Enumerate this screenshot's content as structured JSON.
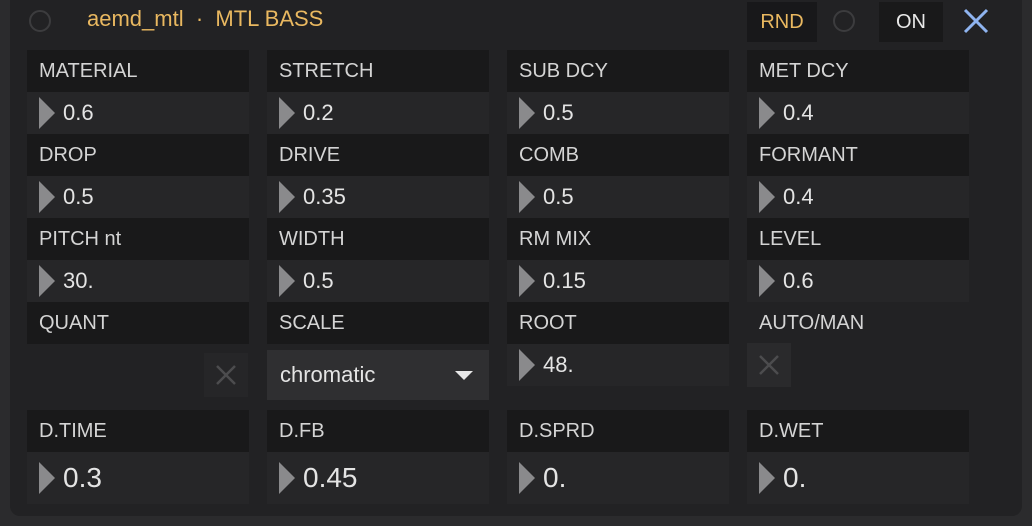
{
  "header": {
    "title": "aemd_mtl  ·  MTL BASS",
    "rnd_label": "RND",
    "on_label": "ON"
  },
  "params": [
    {
      "label": "MATERIAL",
      "value": "0.6"
    },
    {
      "label": "STRETCH",
      "value": "0.2"
    },
    {
      "label": "SUB DCY",
      "value": "0.5"
    },
    {
      "label": "MET DCY",
      "value": "0.4"
    },
    {
      "label": "DROP",
      "value": "0.5"
    },
    {
      "label": "DRIVE",
      "value": "0.35"
    },
    {
      "label": "COMB",
      "value": "0.5"
    },
    {
      "label": "FORMANT",
      "value": "0.4"
    },
    {
      "label": "PITCH nt",
      "value": "30."
    },
    {
      "label": "WIDTH",
      "value": "0.5"
    },
    {
      "label": "RM MIX",
      "value": "0.15"
    },
    {
      "label": "LEVEL",
      "value": "0.6"
    }
  ],
  "row4": {
    "quant_label": "QUANT",
    "scale_label": "SCALE",
    "scale_value": "chromatic",
    "root_label": "ROOT",
    "root_value": "48.",
    "automan_label": "AUTO/MAN"
  },
  "delay": [
    {
      "label": "D.TIME",
      "value": "0.3"
    },
    {
      "label": "D.FB",
      "value": "0.45"
    },
    {
      "label": "D.SPRD",
      "value": "0."
    },
    {
      "label": "D.WET",
      "value": "0."
    }
  ],
  "colors": {
    "accent": "#e9b860",
    "close": "#8fb4f0",
    "panel": "#222224"
  }
}
